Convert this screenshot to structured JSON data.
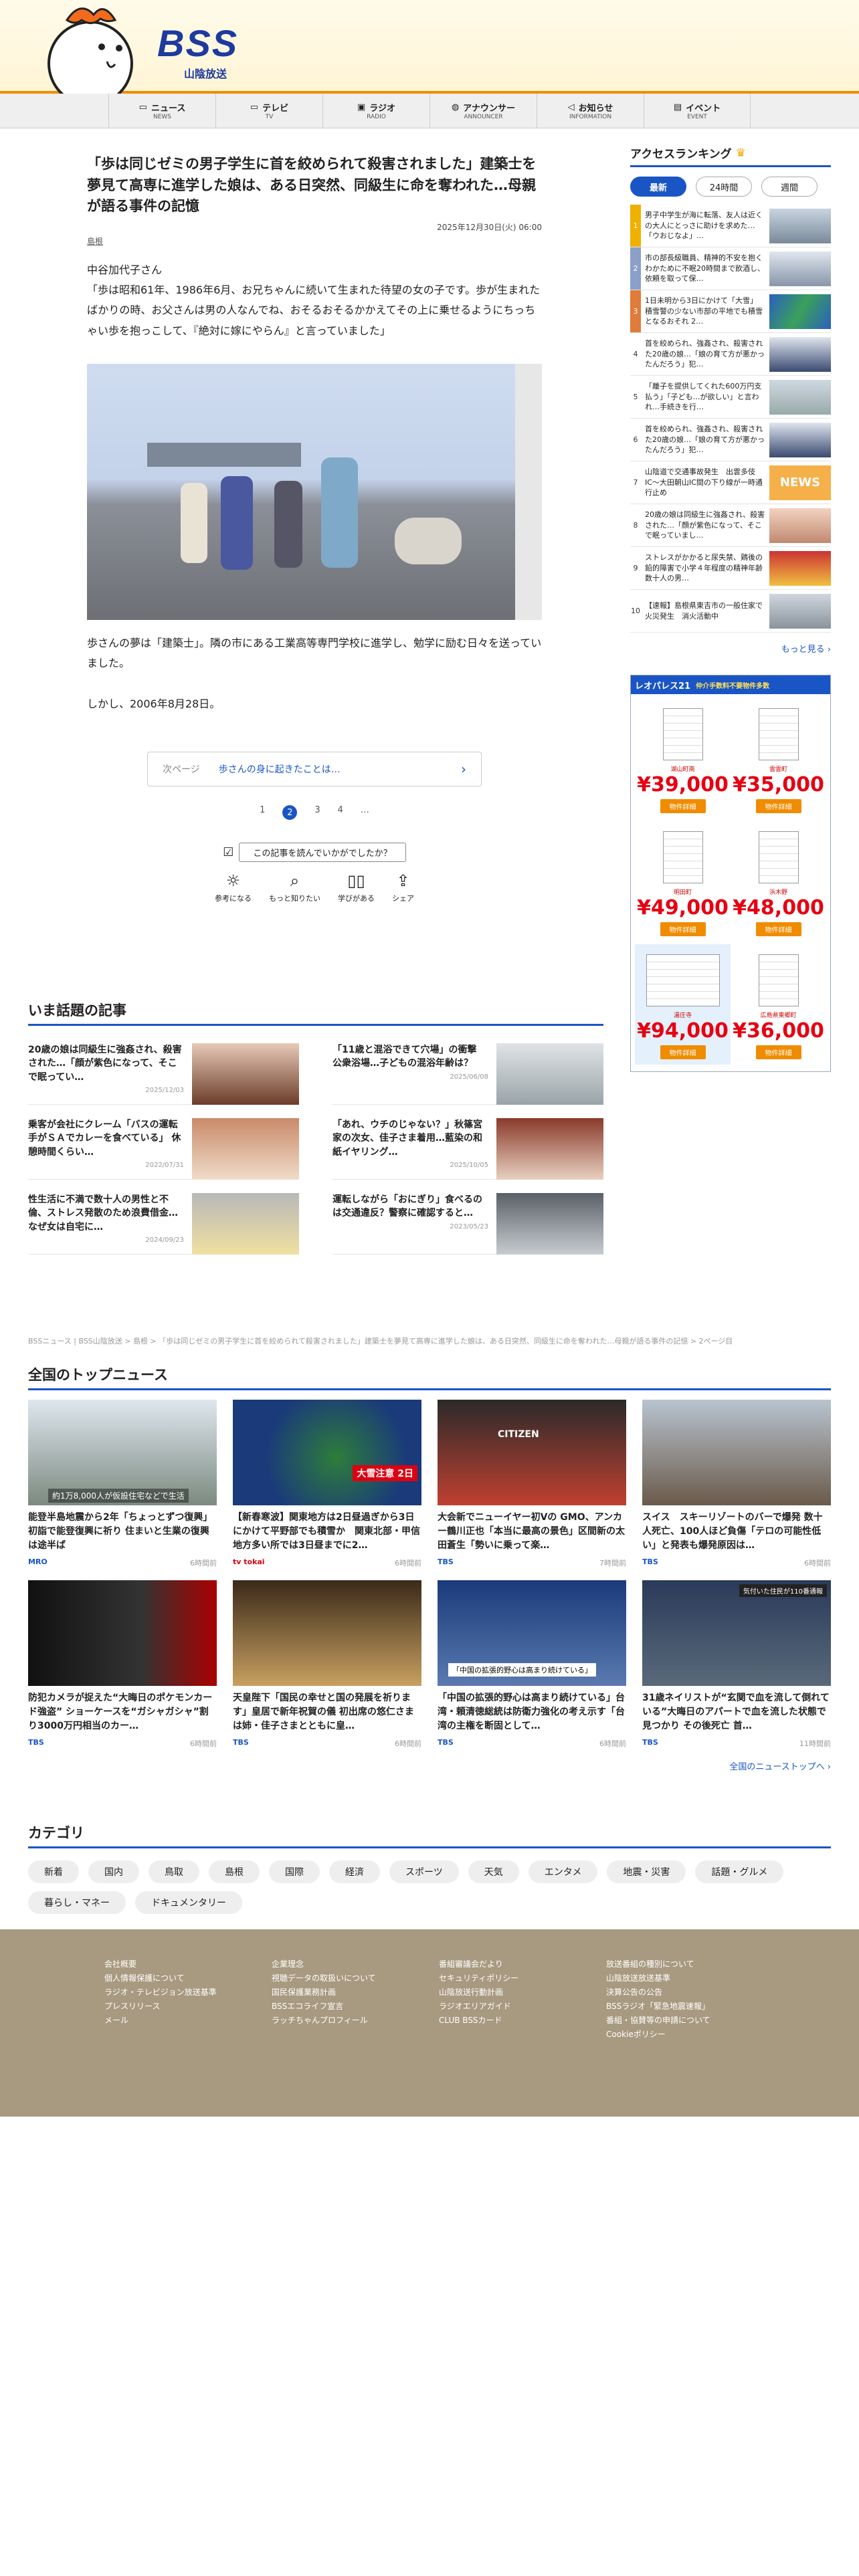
{
  "header": {
    "logo_text": "BSS",
    "logo_sub": "山陰放送"
  },
  "nav": [
    {
      "label": "ニュース",
      "en": "NEWS",
      "icon": "news-icon"
    },
    {
      "label": "テレビ",
      "en": "TV",
      "icon": "tv-icon"
    },
    {
      "label": "ラジオ",
      "en": "RADIO",
      "icon": "radio-icon"
    },
    {
      "label": "アナウンサー",
      "en": "ANNOUNCER",
      "icon": "mic-icon"
    },
    {
      "label": "お知らせ",
      "en": "INFORMATION",
      "icon": "megaphone-icon"
    },
    {
      "label": "イベント",
      "en": "EVENT",
      "icon": "ticket-icon"
    }
  ],
  "article": {
    "title": "「歩は同じゼミの男子学生に首を絞められて殺害されました」建築士を夢見て高専に進学した娘は、ある日突然、同級生に命を奪われた…母親が語る事件の記憶",
    "date": "2025年12月30日(火) 06:00",
    "category": "島根",
    "p1": "中谷加代子さん\n「歩は昭和61年、1986年6月、お兄ちゃんに続いて生まれた待望の女の子です。歩が生まれたばかりの時、お父さんは男の人なんでね、おそるおそるかかえてその上に乗せるようにちっちゃい歩を抱っこして、『絶対に嫁にやらん』と言っていました」",
    "p2": "歩さんの夢は「建築士」。隣の市にある工業高等専門学校に進学し、勉学に励む日々を送っていました。",
    "p3": "しかし、2006年8月28日。",
    "next_label": "次ページ",
    "next_text": "歩さんの身に起きたことは…",
    "pages": [
      "1",
      "2",
      "3",
      "4",
      "…"
    ],
    "reaction_q": "この記事を読んでいかがでしたか？",
    "reactions": [
      "参考になる",
      "もっと知りたい",
      "学びがある",
      "シェア"
    ]
  },
  "recent": {
    "heading": "いま話題の記事",
    "items": [
      {
        "title": "20歳の娘は同級生に強姦され、殺害された…「顔が紫色になって、そこで眠ってい…",
        "date": "2025/12/03"
      },
      {
        "title": "「11歳と混浴できて穴場」の衝撃　公衆浴場…子どもの混浴年齢は？",
        "date": "2025/06/08"
      },
      {
        "title": "乗客が会社にクレーム「バスの運転手がＳＡでカレーを食べている」 休憩時間くらい…",
        "date": "2022/07/31"
      },
      {
        "title": "「あれ、ウチのじゃない？」秋篠宮家の次女、佳子さま着用…藍染の和紙イヤリング…",
        "date": "2025/10/05"
      },
      {
        "title": "性生活に不満で数十人の男性と不倫、ストレス発散のため浪費借金…なぜ女は自宅に…",
        "date": "2024/09/23"
      },
      {
        "title": "運転しながら「おにぎり」食べるのは交通違反？警察に確認すると…",
        "date": "2023/05/23"
      }
    ]
  },
  "breadcrumb": "BSSニュース | BSS山陰放送 > 島根 > 「歩は同じゼミの男子学生に首を絞められて殺害されました」建築士を夢見て高専に進学した娘は、ある日突然、同級生に命を奪われた…母親が語る事件の記憶 > 2ページ目",
  "top_news": {
    "heading": "全国のトップニュース",
    "items": [
      {
        "title": "能登半島地震から2年「ちょっとずつ復興」初詣で能登復興に祈り 住まいと生業の復興は途半ば",
        "src": "MRO",
        "time": "6時間前",
        "caption": "約1万8,000人が仮設住宅などで生活"
      },
      {
        "title": "【新春寒波】関東地方は2日昼過ぎから3日にかけて平野部でも積雪か　関東北部・甲信地方多い所では3日昼までに2…",
        "src": "tv tokai",
        "time": "6時間前",
        "caption": "大雪注意 2日"
      },
      {
        "title": "大会新でニューイヤー初Vの GMO、アンカー鶴川正也「本当に最高の景色」区間新の太田蒼生「勢いに乗って楽…",
        "src": "TBS",
        "time": "7時間前",
        "caption": "CITIZEN"
      },
      {
        "title": "スイス　スキーリゾートのバーで爆発 数十人死亡、100人ほど負傷「テロの可能性低い」と発表も爆発原因は…",
        "src": "TBS",
        "time": "6時間前",
        "caption": ""
      },
      {
        "title": "防犯カメラが捉えた“大晦日のポケモンカード強盗” ショーケースを“ガシャガシャ”割り3000万円相当のカー…",
        "src": "TBS",
        "time": "6時間前",
        "caption": ""
      },
      {
        "title": "天皇陛下「国民の幸せと国の発展を祈ります」皇居で新年祝賀の儀 初出席の悠仁さまは姉・佳子さまとともに皇…",
        "src": "TBS",
        "time": "6時間前",
        "caption": ""
      },
      {
        "title": "「中国の拡張的野心は高まり続けている」台湾・頼清徳総統は防衛力強化の考え示す「台湾の主権を断固として…",
        "src": "TBS",
        "time": "6時間前",
        "caption": "「中国の拡張的野心は高まり続けている」"
      },
      {
        "title": "31歳ネイリストが“玄関で血を流して倒れている”大晦日のアパートで血を流した状態で見つかり その後死亡 首…",
        "src": "TBS",
        "time": "11時間前",
        "caption": "気付いた住民が110番通報"
      }
    ],
    "more": "全国のニューストップへ ›"
  },
  "categories": {
    "heading": "カテゴリ",
    "items": [
      "新着",
      "国内",
      "鳥取",
      "島根",
      "国際",
      "経済",
      "スポーツ",
      "天気",
      "エンタメ",
      "地震・災害",
      "話題・グルメ",
      "暮らし・マネー",
      "ドキュメンタリー"
    ]
  },
  "ranking": {
    "heading": "アクセスランキング",
    "tabs": [
      "最新",
      "24時間",
      "週間"
    ],
    "items": [
      {
        "n": "1",
        "t": "男子中学生が海に転落、友人は近くの大人にとっさに助けを求めた…「ウおじなよ」…"
      },
      {
        "n": "2",
        "t": "市の部長級職員、精神的不安を抱くわかために不眠20時間まで飲酒し、依頼を取って保…"
      },
      {
        "n": "3",
        "t": "1日未明から3日にかけて「大雪」 積雪警の少ない市部の平地でも積雪となるおそれ 2…"
      },
      {
        "n": "4",
        "t": "首を絞められ、強姦され、殺害された20歳の娘…「娘の育て方が悪かったんだろう」犯…"
      },
      {
        "n": "5",
        "t": "「離子を提供してくれた600万円支払う」「子ども…が欲しい」と言われ…手続きを行…"
      },
      {
        "n": "6",
        "t": "首を絞められ、強姦され、殺害された20歳の娘…「娘の育て方が悪かったんだろう」犯…"
      },
      {
        "n": "7",
        "t": "山陰道で交通事故発生　出雲多伎IC〜大田朝山IC間の下り線が一時通行止め"
      },
      {
        "n": "8",
        "t": "20歳の娘は同級生に強姦され、殺害された…「顔が紫色になって、そこで眠っていまし…"
      },
      {
        "n": "9",
        "t": "ストレスがかかると尿失禁、鶏後の鉛的障害で小学４年程度の精神年齢 数十人の男…"
      },
      {
        "n": "10",
        "t": "【速報】島根県東吉市の一般住家で火災発生　消火活動中"
      }
    ],
    "more": "もっと見る ›"
  },
  "ad": {
    "brand": "レオパレス21",
    "slogan": "仲介手数料不要物件多数",
    "items": [
      {
        "name": "湖山町南",
        "price": "¥39,000",
        "btn": "物件詳細"
      },
      {
        "name": "雲雲町",
        "price": "¥35,000",
        "btn": "物件詳細"
      },
      {
        "name": "明田町",
        "price": "¥49,000",
        "btn": "物件詳細"
      },
      {
        "name": "浜木野",
        "price": "¥48,000",
        "btn": "物件詳細"
      },
      {
        "name": "湯庄寺",
        "price": "¥94,000",
        "btn": "物件詳細"
      },
      {
        "name": "広島県東郷町",
        "price": "¥36,000",
        "btn": "物件詳細"
      }
    ]
  },
  "footer": {
    "cols": [
      [
        "会社概要",
        "個人情報保護について",
        "ラジオ・テレビジョン放送基準",
        "プレスリリース",
        "メール"
      ],
      [
        "企業理念",
        "視聴データの取扱いについて",
        "国民保護業務計画",
        "BSSエコライフ宣言",
        "ラッチちゃんプロフィール"
      ],
      [
        "番組審議会だより",
        "セキュリティポリシー",
        "山陰放送行動計画",
        "ラジオエリアガイド",
        "CLUB BSSカード"
      ],
      [
        "放送番組の種別について",
        "山陰放送放送基準",
        "決算公告の公告",
        "BSSラジオ「緊急地震速報」",
        "番組・協賛等の申請について",
        "Cookieポリシー"
      ]
    ]
  },
  "colors": {
    "accent": "#1a55c5",
    "brand_orange": "#f28c00",
    "ad_red": "#e60012"
  }
}
